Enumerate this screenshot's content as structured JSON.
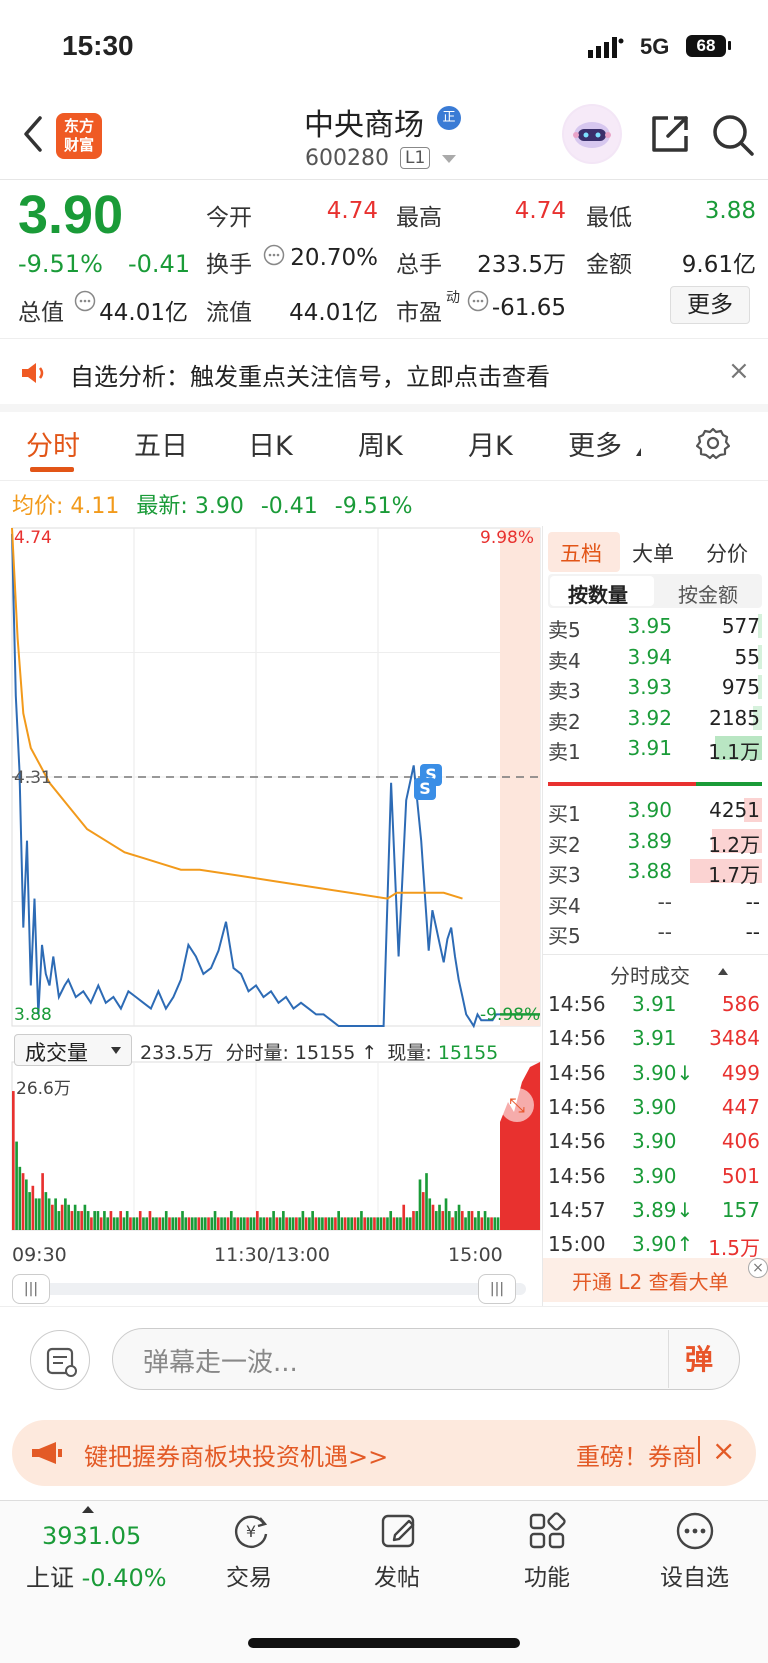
{
  "status_bar": {
    "time": "15:30",
    "network": "5G",
    "battery": "68"
  },
  "header": {
    "logo_line1": "东方",
    "logo_line2": "财富",
    "stock_name": "中央商场",
    "verify_badge": "正",
    "stock_code": "600280",
    "level": "L1"
  },
  "quote": {
    "price": "3.90",
    "change_pct": "-9.51%",
    "change_val": "-0.41",
    "fields": [
      {
        "label": "今开",
        "value": "4.74",
        "color": "red"
      },
      {
        "label": "最高",
        "value": "4.74",
        "color": "red"
      },
      {
        "label": "最低",
        "value": "3.88",
        "color": "green"
      },
      {
        "label": "换手",
        "value": "20.70%",
        "color": "black"
      },
      {
        "label": "总手",
        "value": "233.5万",
        "color": "black"
      },
      {
        "label": "金额",
        "value": "9.61亿",
        "color": "black"
      },
      {
        "label": "总值",
        "value": "44.01亿",
        "color": "black"
      },
      {
        "label": "流值",
        "value": "44.01亿",
        "color": "black"
      },
      {
        "label": "市盈",
        "value": "-61.65",
        "color": "black"
      }
    ],
    "pe_sup": "动",
    "more_label": "更多"
  },
  "notice": {
    "text": "自选分析：触发重点关注信号，立即点击查看",
    "close": "×"
  },
  "tabs": [
    "分时",
    "五日",
    "日K",
    "周K",
    "月K",
    "更多"
  ],
  "info_line": {
    "avg_label": "均价:",
    "avg_value": "4.11",
    "latest_label": "最新:",
    "latest_value": "3.90",
    "change_val": "-0.41",
    "change_pct": "-9.51%"
  },
  "chart_data": {
    "type": "line",
    "title": "",
    "y_left_labels": [
      "4.74",
      "4.31",
      "3.88"
    ],
    "y_right_labels": [
      "9.98%",
      "-9.98%"
    ],
    "ylim": [
      3.88,
      4.74
    ],
    "reference_price": 4.31,
    "x_tick_labels": [
      "09:30",
      "11:30/13:00",
      "15:00"
    ],
    "series": [
      {
        "name": "",
        "color": "#2d6bb5",
        "x": [
          0,
          2,
          4,
          6,
          8,
          10,
          12,
          14,
          16,
          18,
          20,
          22,
          25,
          28,
          30,
          34,
          38,
          42,
          46,
          50,
          54,
          58,
          62,
          66,
          70,
          74,
          78,
          82,
          86,
          90,
          94,
          98,
          102,
          106,
          110,
          114,
          118,
          122,
          126,
          130,
          134,
          138,
          142,
          146,
          150,
          154,
          158,
          162,
          166,
          170,
          174,
          178,
          182,
          186,
          190,
          194,
          198,
          202,
          206,
          210,
          214,
          218,
          222,
          224,
          226,
          228,
          230,
          232,
          234,
          236,
          238,
          240,
          242,
          244,
          246,
          248,
          250,
          252,
          254,
          256,
          258,
          260
        ],
        "values": [
          4.73,
          4.45,
          4.32,
          4.05,
          4.2,
          3.95,
          4.1,
          3.9,
          4.02,
          3.97,
          3.95,
          4.0,
          3.93,
          3.95,
          3.96,
          3.93,
          3.94,
          3.92,
          3.95,
          3.92,
          3.93,
          3.91,
          3.94,
          3.93,
          3.92,
          3.91,
          3.94,
          3.91,
          3.93,
          3.96,
          4.02,
          4.0,
          3.97,
          3.98,
          4.01,
          4.06,
          3.98,
          3.97,
          3.94,
          3.95,
          3.93,
          3.94,
          3.92,
          3.93,
          3.91,
          3.92,
          3.91,
          3.9,
          3.9,
          3.89,
          3.88,
          3.88,
          3.88,
          3.88,
          3.88,
          3.88,
          3.88,
          4.3,
          4.0,
          4.27,
          4.33,
          4.2,
          4.01,
          4.08,
          4.05,
          4.02,
          3.99,
          4.03,
          4.05,
          4.0,
          3.96,
          3.93,
          3.9,
          3.89,
          3.88,
          3.9,
          3.89,
          3.89,
          3.89,
          3.89,
          3.9,
          3.9
        ]
      },
      {
        "name": "",
        "color": "#f29a1b",
        "x": [
          0,
          3,
          6,
          10,
          15,
          20,
          30,
          40,
          50,
          60,
          70,
          80,
          90,
          100,
          120,
          140,
          160,
          180,
          200,
          205,
          210,
          220,
          230,
          240
        ],
        "values": [
          4.74,
          4.55,
          4.42,
          4.36,
          4.33,
          4.3,
          4.26,
          4.22,
          4.2,
          4.18,
          4.17,
          4.16,
          4.15,
          4.15,
          4.14,
          4.13,
          4.12,
          4.11,
          4.1,
          4.11,
          4.11,
          4.11,
          4.11,
          4.1
        ]
      }
    ],
    "volume": {
      "ymax_label": "26.6万",
      "values": [
        22,
        14,
        10,
        9,
        8,
        6,
        7,
        5,
        5,
        9,
        6,
        5,
        4,
        5,
        3,
        4,
        5,
        4,
        3,
        4,
        3,
        3,
        4,
        3,
        2,
        3,
        3,
        2,
        3,
        2,
        3,
        2,
        2,
        3,
        2,
        3,
        2,
        2,
        2,
        3,
        2,
        2,
        3,
        2,
        2,
        2,
        2,
        3,
        2,
        2,
        2,
        2,
        3,
        2,
        2,
        2,
        2,
        2,
        2,
        2,
        2,
        2,
        3,
        2,
        2,
        2,
        2,
        3,
        2,
        2,
        2,
        2,
        2,
        2,
        2,
        3,
        2,
        2,
        2,
        2,
        3,
        2,
        2,
        3,
        2,
        2,
        2,
        2,
        2,
        3,
        2,
        2,
        3,
        2,
        2,
        2,
        2,
        2,
        2,
        2,
        3,
        2,
        2,
        2,
        2,
        2,
        2,
        3,
        2,
        2,
        2,
        2,
        2,
        2,
        2,
        2,
        3,
        2,
        2,
        2,
        4,
        2,
        2,
        3,
        3,
        8,
        6,
        9,
        5,
        4,
        3,
        4,
        3,
        5,
        3,
        2,
        3,
        4,
        3,
        2,
        3,
        3,
        2,
        3,
        2,
        3,
        2,
        2,
        2,
        2
      ]
    }
  },
  "order_book": {
    "tabs": [
      "五档",
      "大单",
      "分价"
    ],
    "subtabs": [
      "按数量",
      "按金额"
    ],
    "asks": [
      {
        "label": "卖5",
        "price": "3.95",
        "vol": "577",
        "bar": 0.06
      },
      {
        "label": "卖4",
        "price": "3.94",
        "vol": "55",
        "bar": 0.01
      },
      {
        "label": "卖3",
        "price": "3.93",
        "vol": "975",
        "bar": 0.06
      },
      {
        "label": "卖2",
        "price": "3.92",
        "vol": "2185",
        "bar": 0.13
      },
      {
        "label": "卖1",
        "price": "3.91",
        "vol": "1.1万",
        "bar": 0.65
      }
    ],
    "bids": [
      {
        "label": "买1",
        "price": "3.90",
        "vol": "4251",
        "bar": 0.25
      },
      {
        "label": "买2",
        "price": "3.89",
        "vol": "1.2万",
        "bar": 0.7
      },
      {
        "label": "买3",
        "price": "3.88",
        "vol": "1.7万",
        "bar": 1.0
      },
      {
        "label": "买4",
        "price": "--",
        "vol": "--",
        "bar": 0
      },
      {
        "label": "买5",
        "price": "--",
        "vol": "--",
        "bar": 0
      }
    ],
    "trades_title": "分时成交",
    "trades": [
      {
        "time": "14:56",
        "price": "3.91",
        "arrow": "",
        "vol": "586",
        "price_color": "green",
        "vol_color": "red"
      },
      {
        "time": "14:56",
        "price": "3.91",
        "arrow": "",
        "vol": "3484",
        "price_color": "green",
        "vol_color": "red"
      },
      {
        "time": "14:56",
        "price": "3.90",
        "arrow": "↓",
        "vol": "499",
        "price_color": "green",
        "vol_color": "red"
      },
      {
        "time": "14:56",
        "price": "3.90",
        "arrow": "",
        "vol": "447",
        "price_color": "green",
        "vol_color": "red"
      },
      {
        "time": "14:56",
        "price": "3.90",
        "arrow": "",
        "vol": "406",
        "price_color": "green",
        "vol_color": "red"
      },
      {
        "time": "14:56",
        "price": "3.90",
        "arrow": "",
        "vol": "501",
        "price_color": "green",
        "vol_color": "red"
      },
      {
        "time": "14:57",
        "price": "3.89",
        "arrow": "↓",
        "vol": "157",
        "price_color": "green",
        "vol_color": "green"
      },
      {
        "time": "15:00",
        "price": "3.90",
        "arrow": "↑",
        "vol": "1.5万",
        "price_color": "green",
        "vol_color": "red"
      }
    ],
    "l2_promo": "开通 L2 查看大单",
    "l2_close": "×"
  },
  "volume_header": {
    "select_label": "成交量",
    "total": "233.5万",
    "minute_label": "分时量: ",
    "minute_value": "15155",
    "arrow": "↑",
    "current_label": "现量: ",
    "current_value": "15155"
  },
  "danmu": {
    "placeholder": "弹幕走一波...",
    "send": "弹"
  },
  "banner": {
    "text": "键把握券商板块投资机遇>>",
    "right": "重磅！券商",
    "close": "×"
  },
  "bottom_nav": {
    "index_value": "3931.05",
    "index_name": "上证",
    "index_change": "-0.40%",
    "items": [
      {
        "label": "交易",
        "icon": "yen-refresh-icon"
      },
      {
        "label": "发帖",
        "icon": "edit-icon"
      },
      {
        "label": "功能",
        "icon": "grid-icon"
      },
      {
        "label": "设自选",
        "icon": "more-dots-icon"
      }
    ]
  },
  "colors": {
    "up": "#e8312f",
    "down": "#1a9b38",
    "price_line": "#2d6bb5",
    "avg_line": "#f29a1b",
    "accent": "#e25517"
  }
}
